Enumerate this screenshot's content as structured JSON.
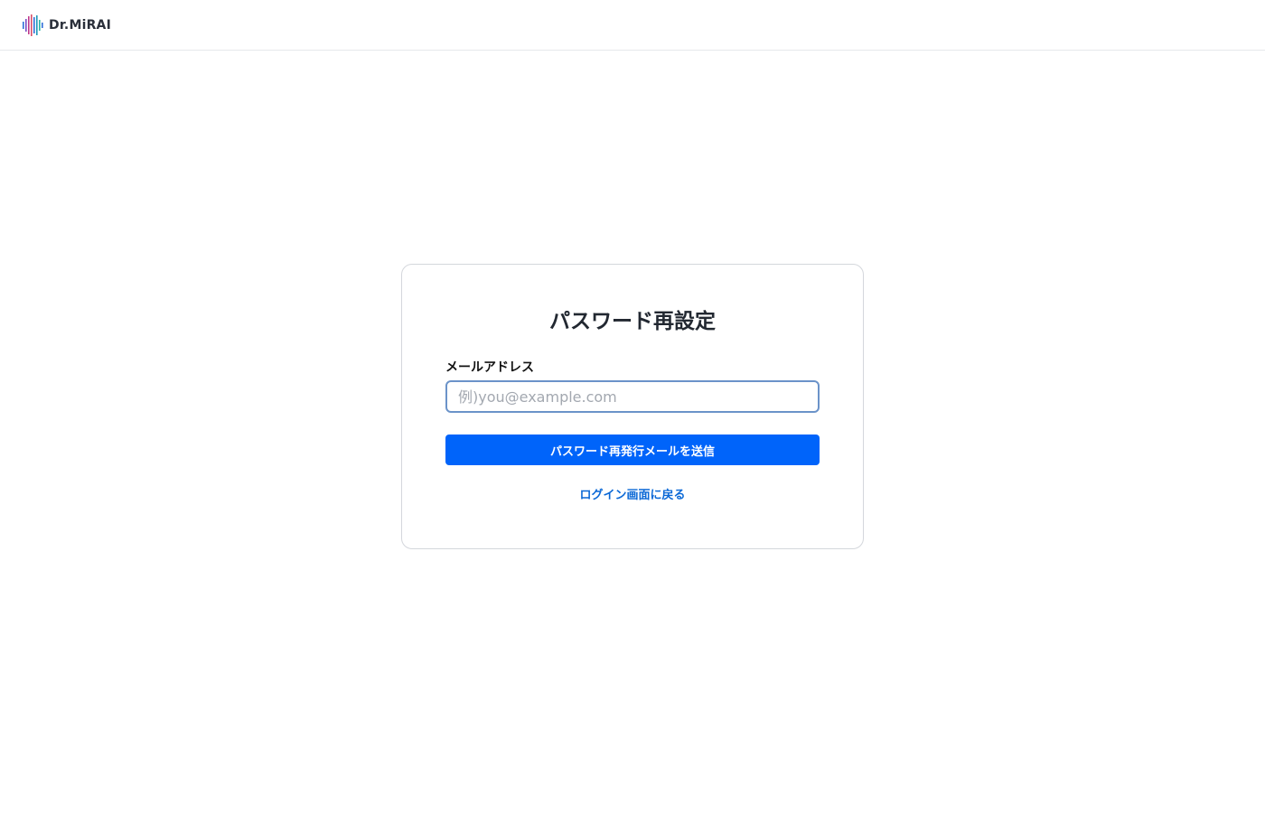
{
  "header": {
    "logo_text": "Dr.MiRAI",
    "logo_icon": "waveform-bars-icon",
    "logo_colors": [
      "#2e6fd8",
      "#7a4fc4",
      "#c0398a",
      "#d84f6a",
      "#2e6fd8",
      "#1f9ab8",
      "#2bb3a8",
      "#2e6fd8"
    ]
  },
  "card": {
    "title": "パスワード再設定",
    "email_label": "メールアドレス",
    "email_value": "",
    "email_placeholder": "例)you@example.com",
    "submit_label": "パスワード再発行メールを送信",
    "back_link_label": "ログイン画面に戻る"
  },
  "colors": {
    "primary": "#0064fa",
    "link": "#0a68d6",
    "border": "#d4d7dc",
    "input_focus_border": "#6b93c9"
  }
}
